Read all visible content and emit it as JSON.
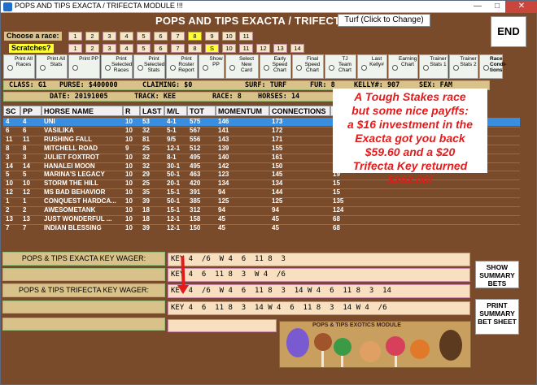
{
  "window": {
    "title": "POPS AND TIPS EXACTA / TRIFECTA MODULE !!!",
    "minimize": "—",
    "maximize": "□",
    "close": "✕"
  },
  "header": {
    "title": "POPS AND TIPS EXACTA / TRIFECTA M",
    "surface_button": "Turf (Click to Change)",
    "end_button": "END"
  },
  "race_select": {
    "choose_label": "Choose  a race:",
    "scratches_label": "Scratches?",
    "race_numbers": [
      "1",
      "2",
      "3",
      "4",
      "5",
      "6",
      "7",
      "8",
      "9",
      "10",
      "11"
    ],
    "selected_race": "8",
    "scratch_numbers": [
      "1",
      "2",
      "3",
      "4",
      "5",
      "6",
      "7",
      "8",
      "S",
      "10",
      "11",
      "12",
      "13",
      "14"
    ],
    "scratch_highlight": "S"
  },
  "options": [
    {
      "label": "Print All Races",
      "bold": false
    },
    {
      "label": "Print All Stats",
      "bold": false
    },
    {
      "label": "Print PP",
      "bold": false
    },
    {
      "label": "Print Selected Races",
      "bold": false
    },
    {
      "label": "Print Selected Stats",
      "bold": false
    },
    {
      "label": "Print Roster Report",
      "bold": false
    },
    {
      "label": "Show PP",
      "bold": false
    },
    {
      "label": "Select New Card",
      "bold": false
    },
    {
      "label": "Early Speed Chart",
      "bold": false
    },
    {
      "label": "Final Speed Chart",
      "bold": false
    },
    {
      "label": "TJ Team Chart",
      "bold": false
    },
    {
      "label": "Last Kelly#",
      "bold": false
    },
    {
      "label": "Earning Chart",
      "bold": false
    },
    {
      "label": "Trainer Stats 1",
      "bold": false
    },
    {
      "label": "Trainer Stats 2",
      "bold": false
    },
    {
      "label": "Race Condi-tions",
      "bold": true
    }
  ],
  "race_info": {
    "line1": [
      "CLASS: G1",
      "PURSE: $400000",
      "CLAIMING: $0",
      "SURF: TURF",
      "FUR: 8",
      "KELLY#: 907",
      "SEX: FAM"
    ],
    "line2": [
      "DATE: 20191005",
      "TRACK: KEE",
      "RACE: 8",
      "HORSES: 14"
    ]
  },
  "table": {
    "columns": [
      "SC",
      "PP",
      "HORSE NAME",
      "R",
      "LAST",
      "M/L",
      "TOT",
      "MOMENTUM",
      "CONNECTIONS",
      "CO"
    ],
    "rows": [
      [
        "4",
        "4",
        "UNI",
        "10",
        "53",
        "4-1",
        "575",
        "146",
        "173",
        "25"
      ],
      [
        "6",
        "6",
        "VASILIKA",
        "10",
        "32",
        "5-1",
        "567",
        "141",
        "172",
        "25"
      ],
      [
        "11",
        "11",
        "RUSHING FALL",
        "10",
        "81",
        "9/5",
        "556",
        "143",
        "171",
        "24"
      ],
      [
        "8",
        "8",
        "MITCHELL ROAD",
        "9",
        "25",
        "12-1",
        "512",
        "139",
        "155",
        "20"
      ],
      [
        "3",
        "3",
        "JULIET FOXTROT",
        "10",
        "32",
        "8-1",
        "495",
        "140",
        "161",
        "19"
      ],
      [
        "14",
        "14",
        "HANALEI MOON",
        "10",
        "32",
        "30-1",
        "495",
        "142",
        "150",
        "20"
      ],
      [
        "5",
        "5",
        "MARINA'S LEGACY",
        "10",
        "29",
        "50-1",
        "463",
        "123",
        "145",
        "19"
      ],
      [
        "10",
        "10",
        "STORM THE HILL",
        "10",
        "25",
        "20-1",
        "420",
        "134",
        "134",
        "15"
      ],
      [
        "12",
        "12",
        "MS BAD BEHAVIOR",
        "10",
        "35",
        "15-1",
        "391",
        "94",
        "144",
        "15"
      ],
      [
        "1",
        "1",
        "CONQUEST HARDCA...",
        "10",
        "39",
        "50-1",
        "385",
        "125",
        "125",
        "135"
      ],
      [
        "2",
        "2",
        "AWESOMETANK",
        "10",
        "18",
        "15-1",
        "312",
        "94",
        "94",
        "124"
      ],
      [
        "13",
        "13",
        "JUST WONDERFUL ...",
        "10",
        "18",
        "12-1",
        "158",
        "45",
        "45",
        "68"
      ],
      [
        "7",
        "7",
        "INDIAN BLESSING",
        "10",
        "39",
        "12-1",
        "150",
        "45",
        "45",
        "68"
      ]
    ]
  },
  "callout": {
    "lines": [
      "A Tough Stakes race",
      "but some nice payffs:",
      "a $16 investment in the",
      "Exacta got you back",
      "$59.60 and a $20",
      "Trifecta Key returned",
      "$262.00!"
    ],
    "color": "#e41b1b"
  },
  "wagers": {
    "exacta_label": "POPS & TIPS EXACTA KEY WAGER:",
    "trifecta_label": "POPS & TIPS TRIFECTA KEY WAGER:",
    "exacta_lines": [
      "KEY 4  /6  W 4  6  11 8  3",
      "KEY 4  6  11 8  3  W 4  /6"
    ],
    "trifecta_lines": [
      "KEY 4  /6  W 4  6  11 8  3  14 W 4  6  11 8  3  14",
      "KEY 4  6  11 8  3  14 W 4  6  11 8  3  14 W 4  /6"
    ]
  },
  "side_buttons": {
    "show_summary": "SHOW SUMMARY BETS",
    "print_summary": "PRINT SUMMARY BET SHEET"
  },
  "logo": {
    "text": "POPS & TIPS EXOTICS MODULE"
  },
  "colors": {
    "background": "#7a4b2a",
    "panel": "#d9c28a",
    "selected_row": "#3a8ee0",
    "callout_text": "#e41b1b"
  }
}
